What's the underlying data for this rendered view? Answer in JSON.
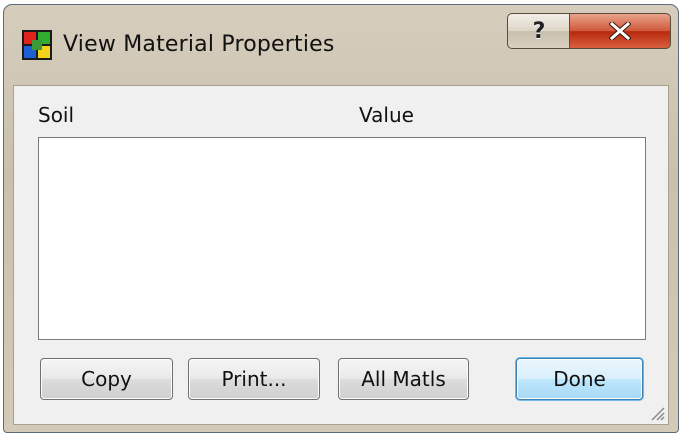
{
  "window": {
    "title": "View Material Properties",
    "help_button": "?",
    "close_button": "X",
    "app_icon": "program-icon"
  },
  "list": {
    "columns": [
      "Soil",
      "Value"
    ],
    "rows": []
  },
  "buttons": {
    "copy": "Copy",
    "print": "Print...",
    "all_matls": "All Matls",
    "done": "Done"
  },
  "colors": {
    "frame": "#c9c0ad",
    "close_red": "#c83a1c",
    "default_button_blue": "#bee6fd"
  }
}
